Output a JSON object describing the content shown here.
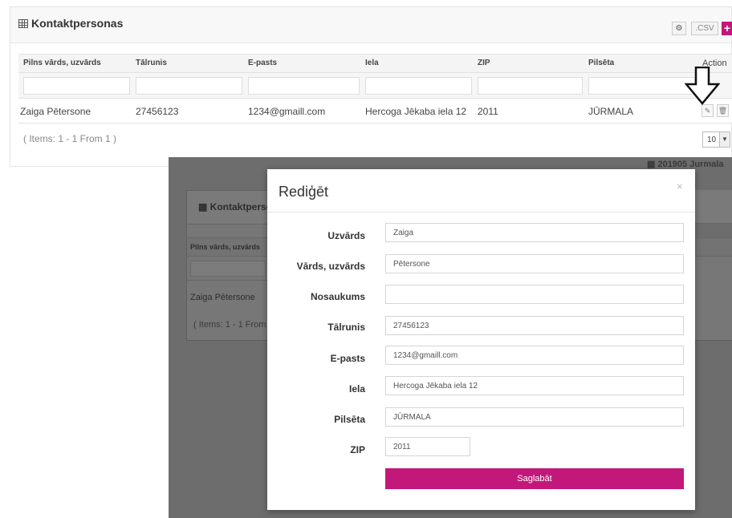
{
  "panel": {
    "title": "Kontaktpersonas",
    "csv_label": ".CSV",
    "add_label": "+",
    "gear_label": "⚙"
  },
  "table": {
    "columns": [
      "Pilns vārds, uzvārds",
      "Tālrunis",
      "E-pasts",
      "Iela",
      "ZIP",
      "Pilsēta",
      "Action"
    ],
    "rows": [
      {
        "full_name": "Zaiga Pētersone",
        "phone": "27456123",
        "email": "1234@gmaill.com",
        "street": "Hercoga Jēkaba iela 12",
        "zip": "2011",
        "city": "JŪRMALA"
      }
    ],
    "items_text": "( Items: 1 - 1 From 1 )",
    "page_size": "10"
  },
  "backdrop": {
    "date_text": "201905 Jurmala",
    "panel_title": "Kontaktperso",
    "col_header": "Pilns vārds, uzvārds",
    "row_name": "Zaiga Pētersone",
    "items_text": "( Items: 1 - 1 From"
  },
  "modal": {
    "title": "Rediģēt",
    "close": "×",
    "fields": [
      {
        "label": "Uzvārds",
        "value": "Zaiga"
      },
      {
        "label": "Vārds, uzvārds",
        "value": "Pētersone"
      },
      {
        "label": "Nosaukums",
        "value": ""
      },
      {
        "label": "Tālrunis",
        "value": "27456123"
      },
      {
        "label": "E-pasts",
        "value": "1234@gmaill.com"
      },
      {
        "label": "Iela",
        "value": "Hercoga Jēkaba iela 12"
      },
      {
        "label": "Pilsēta",
        "value": "JŪRMALA"
      },
      {
        "label": "ZIP",
        "value": "2011"
      }
    ],
    "save_label": "Saglabāt"
  },
  "colors": {
    "accent": "#c2187a",
    "backdrop": "#6d6d6d"
  }
}
